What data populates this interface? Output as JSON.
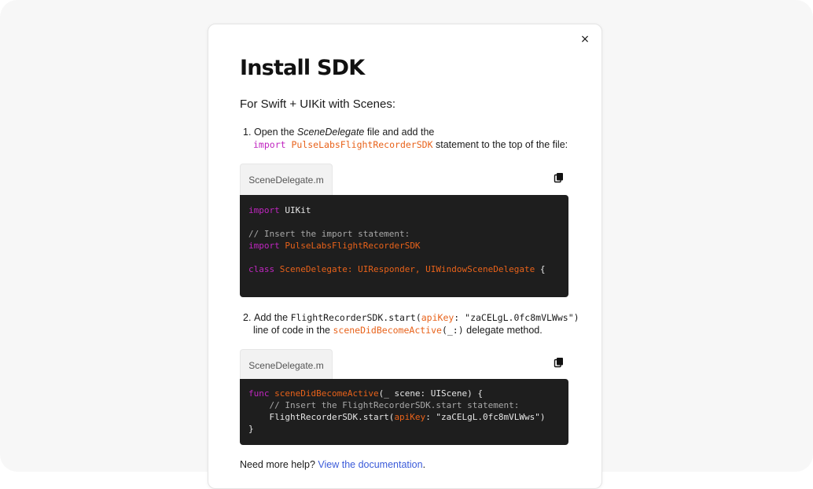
{
  "modal": {
    "close_glyph": "×",
    "title": "Install SDK",
    "subtitle": "For Swift + UIKit with Scenes:"
  },
  "step1": {
    "number": "1.",
    "text_a": "Open the ",
    "file_name": "SceneDelegate",
    "text_b": " file and add the",
    "import_kw": "import",
    "module": "PulseLabsFlightRecorderSDK",
    "text_c": " statement to the top of the file:",
    "tab_label": "SceneDelegate.m",
    "code": {
      "l1_kw": "import",
      "l1_rest": " UIKit",
      "l2": "// Insert the import statement:",
      "l3_kw": "import",
      "l3_mod": " PulseLabsFlightRecorderSDK",
      "l4_kw": "class",
      "l4_rest": " SceneDelegate: UIResponder, UIWindowSceneDelegate",
      "l4_brace": " {"
    }
  },
  "step2": {
    "number": "2.",
    "text_a": "Add the ",
    "call_a": "FlightRecorderSDK.start(",
    "call_param": "apiKey",
    "call_b": ": \"zaCELgL.0fc8mVLWws\")",
    "text_b": "line of code in the ",
    "method": "sceneDidBecomeActive",
    "method_args": "(_:)",
    "text_c": " delegate method.",
    "tab_label": "SceneDelegate.m",
    "code": {
      "l1_kw": "func",
      "l1_fn": " sceneDidBecomeActive",
      "l1_rest": "(_ scene: UIScene) {",
      "l2": "    // Insert the FlightRecorderSDK.start statement:",
      "l3_a": "    FlightRecorderSDK.start(",
      "l3_param": "apiKey",
      "l3_b": ": \"zaCELgL.0fc8mVLWws\")",
      "l4": "}"
    }
  },
  "help": {
    "text": "Need more help? ",
    "link": "View the documentation",
    "end": "."
  },
  "icons": {
    "close": "close-icon",
    "copy": "copy-icon"
  },
  "colors": {
    "keyword": "#c026c0",
    "identifier": "#e8621a",
    "comment": "#a8a8a8",
    "link": "#3b5bd9",
    "code_bg": "#1e1e1e"
  }
}
